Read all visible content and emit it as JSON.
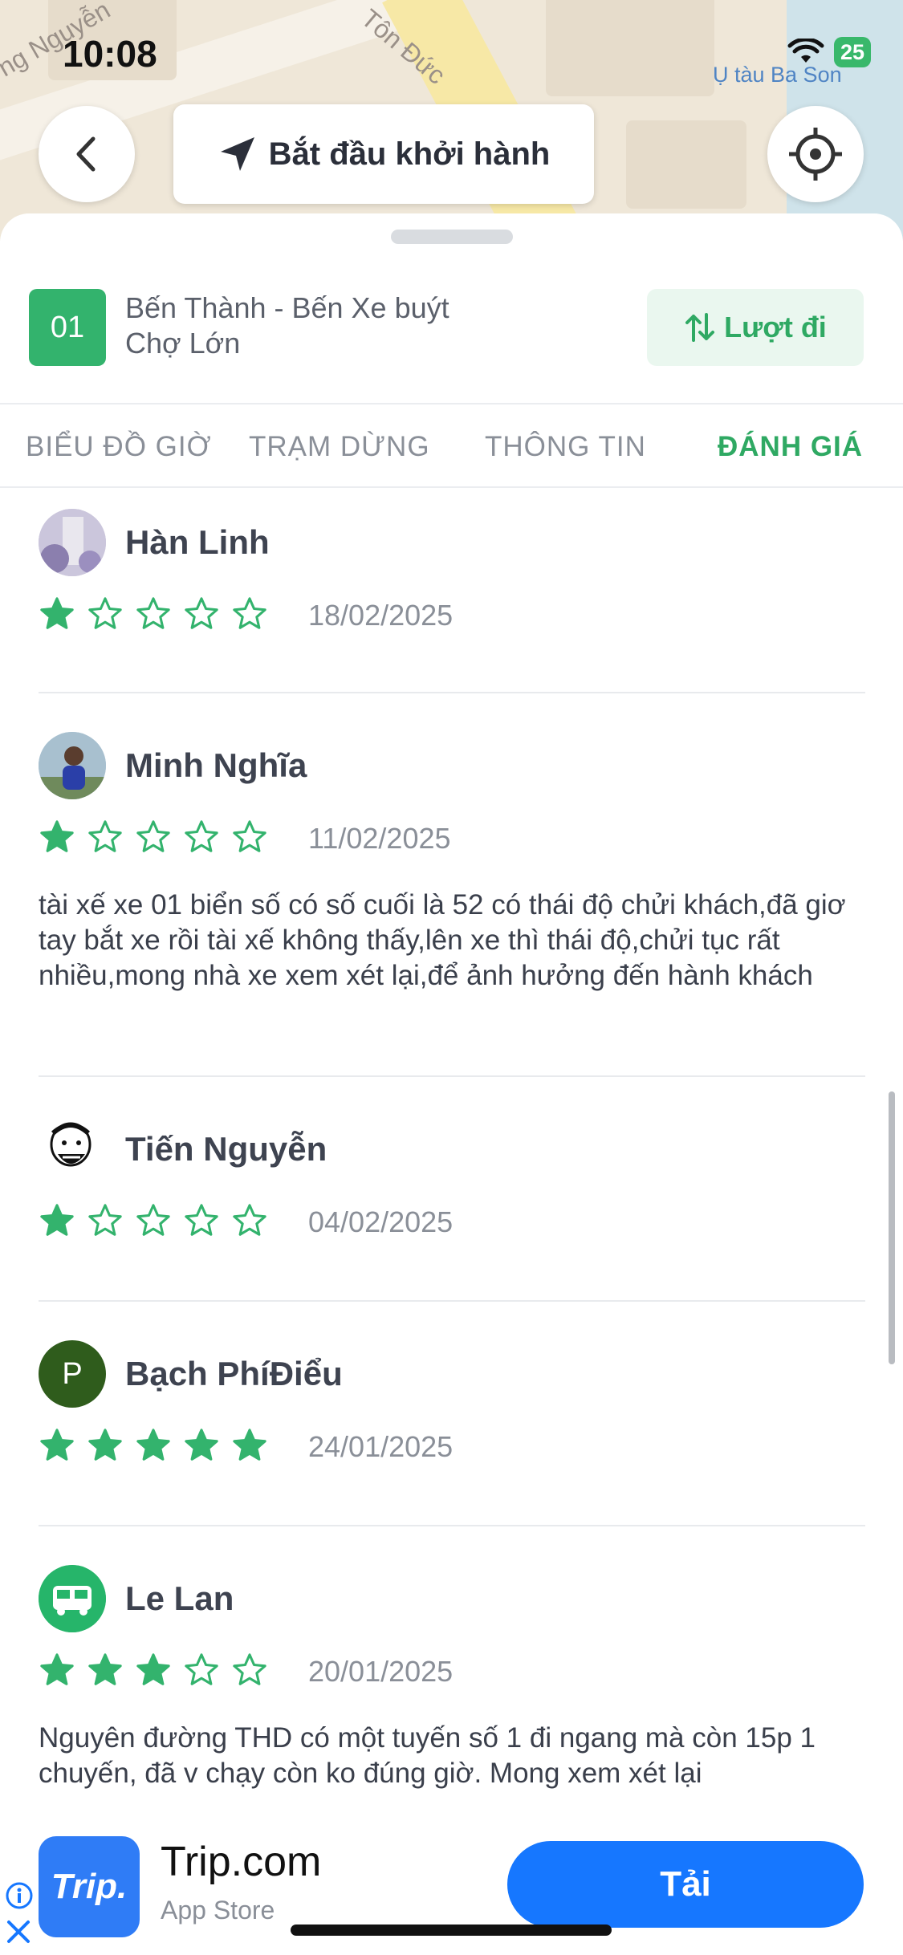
{
  "status_bar": {
    "time": "10:08",
    "battery": "25"
  },
  "map": {
    "labels": [
      "ng Nguyễn",
      "Tôn Đức",
      "Ụ tàu Ba Son"
    ]
  },
  "top_bar": {
    "start_trip_label": "Bắt đầu khởi hành"
  },
  "route": {
    "number": "01",
    "name_line1": "Bến Thành - Bến Xe buýt",
    "name_line2": "Chợ Lớn",
    "direction_label": "Lượt đi",
    "accent_color": "#33b36d"
  },
  "tabs": [
    {
      "label": "BIỂU ĐỒ GIỜ",
      "active": false
    },
    {
      "label": "TRẠM DỪNG",
      "active": false
    },
    {
      "label": "THÔNG TIN",
      "active": false
    },
    {
      "label": "ĐÁNH GIÁ",
      "active": true
    }
  ],
  "reviews": [
    {
      "name": "Hàn Linh",
      "rating": 1,
      "date": "18/02/2025",
      "text": "",
      "avatar": "photo"
    },
    {
      "name": "Minh Nghĩa",
      "rating": 1,
      "date": "11/02/2025",
      "text": "tài xế xe 01 biển số có số cuối là 52 có thái độ chửi khách,đã giơ tay bắt xe rồi tài xế không thấy,lên xe thì thái độ,chửi tục rất nhiều,mong nhà xe xem xét lại,để ảnh hưởng đến hành khách",
      "avatar": "photo"
    },
    {
      "name": "Tiến Nguyễn",
      "rating": 1,
      "date": "04/02/2025",
      "text": "",
      "avatar": "meme"
    },
    {
      "name": "Bạch PhíĐiểu",
      "rating": 5,
      "date": "24/01/2025",
      "text": "",
      "avatar": "letter",
      "avatar_letter": "P"
    },
    {
      "name": "Le Lan",
      "rating": 3,
      "date": "20/01/2025",
      "text": "Nguyên đường THD có một tuyến số 1 đi ngang mà còn 15p 1 chuyến, đã v chạy còn ko đúng giờ. Mong xem xét lại",
      "avatar": "bus-icon"
    }
  ],
  "ad": {
    "logo_text": "Trip.",
    "title": "Trip.com",
    "subtitle": "App Store",
    "button_label": "Tải"
  }
}
